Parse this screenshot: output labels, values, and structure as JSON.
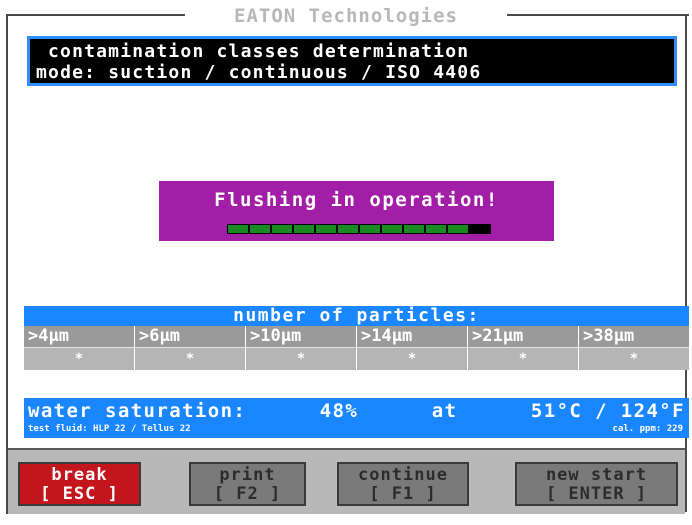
{
  "title": "EATON Technologies",
  "header": {
    "line1": "contamination classes determination",
    "line2": "mode: suction / continuous / ISO 4406"
  },
  "flushing": {
    "message": "Flushing in operation!",
    "progress_segments_filled": 11,
    "progress_segments_total": 12
  },
  "particles": {
    "heading": "number of particles:",
    "columns": [
      {
        "label": ">4µm",
        "value": "*"
      },
      {
        "label": ">6µm",
        "value": "*"
      },
      {
        "label": ">10µm",
        "value": "*"
      },
      {
        "label": ">14µm",
        "value": "*"
      },
      {
        "label": ">21µm",
        "value": "*"
      },
      {
        "label": ">38µm",
        "value": "*"
      }
    ]
  },
  "water": {
    "label": "water saturation:",
    "percent": "48%",
    "at": "at",
    "temp": "51°C / 124°F",
    "fluid": "test fluid: HLP 22 / Tellus 22",
    "cal": "cal. ppm: 229"
  },
  "buttons": {
    "break": {
      "line1": "break",
      "line2": "[ ESC ]"
    },
    "print": {
      "line1": "print",
      "line2": "[ F2 ]"
    },
    "continue": {
      "line1": "continue",
      "line2": "[ F1 ]"
    },
    "newstart": {
      "line1": "new start",
      "line2": "[ ENTER ]"
    }
  },
  "colors": {
    "accent_blue": "#1a86ff",
    "flush_purple": "#a21ea6",
    "progress_green": "#1c8a22",
    "break_red": "#c2161c"
  }
}
